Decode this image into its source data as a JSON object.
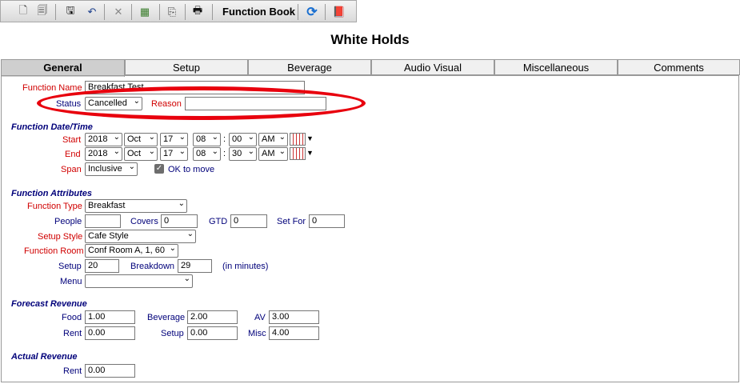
{
  "toolbar": {
    "buttons": [
      {
        "name": "new-doc-icon",
        "glyph": "🗋"
      },
      {
        "name": "copy-doc-icon",
        "glyph": "🗐"
      },
      {
        "name": "save-icon",
        "glyph": "🖫"
      },
      {
        "name": "undo-icon",
        "glyph": "↶"
      },
      {
        "name": "delete-icon",
        "glyph": "✕"
      },
      {
        "name": "calculator-icon",
        "glyph": "▦"
      },
      {
        "name": "pages-icon",
        "glyph": "⎘"
      },
      {
        "name": "print-icon",
        "glyph": "🖶"
      },
      {
        "name": "refresh-icon",
        "glyph": "⟳"
      },
      {
        "name": "book-icon",
        "glyph": "📕"
      }
    ],
    "function_book_label": "Function Book"
  },
  "page_title": "White Holds",
  "tabs": [
    "General",
    "Setup",
    "Beverage",
    "Audio Visual",
    "Miscellaneous",
    "Comments"
  ],
  "form": {
    "function_name_label": "Function Name",
    "function_name_value": "Breakfast Test",
    "status_label": "Status",
    "status_value": "Cancelled",
    "reason_label": "Reason",
    "reason_value": "",
    "date_section": "Function Date/Time",
    "start_label": "Start",
    "start": {
      "year": "2018",
      "month": "Oct",
      "day": "17",
      "hour": "08",
      "minute": "00",
      "ampm": "AM"
    },
    "end_label": "End",
    "end": {
      "year": "2018",
      "month": "Oct",
      "day": "17",
      "hour": "08",
      "minute": "30",
      "ampm": "AM"
    },
    "span_label": "Span",
    "span_value": "Inclusive",
    "ok_to_move_label": "OK to move",
    "ok_to_move_checked": true,
    "attributes_section": "Function Attributes",
    "function_type_label": "Function Type",
    "function_type_value": "Breakfast",
    "people_label": "People",
    "people_value": "",
    "covers_label": "Covers",
    "covers_value": "0",
    "gtd_label": "GTD",
    "gtd_value": "0",
    "set_for_label": "Set For",
    "set_for_value": "0",
    "setup_style_label": "Setup Style",
    "setup_style_value": "Cafe Style",
    "function_room_label": "Function Room",
    "function_room_value": "Conf Room A, 1, 60",
    "setup_label": "Setup",
    "setup_value": "20",
    "breakdown_label": "Breakdown",
    "breakdown_value": "29",
    "in_minutes_label": "(in minutes)",
    "menu_label": "Menu",
    "menu_value": "",
    "forecast_section": "Forecast Revenue",
    "food_label": "Food",
    "food_value": "1.00",
    "beverage_label": "Beverage",
    "beverage_value": "2.00",
    "av_label": "AV",
    "av_value": "3.00",
    "rent_label": "Rent",
    "rent_value": "0.00",
    "setup_rev_label": "Setup",
    "setup_rev_value": "0.00",
    "misc_label": "Misc",
    "misc_value": "4.00",
    "actual_section": "Actual Revenue",
    "actual_rent_label": "Rent",
    "actual_rent_value": "0.00"
  },
  "colors": {
    "highlight_oval": "#e8000d",
    "label_red": "#d00000",
    "label_blue": "#00007a"
  }
}
